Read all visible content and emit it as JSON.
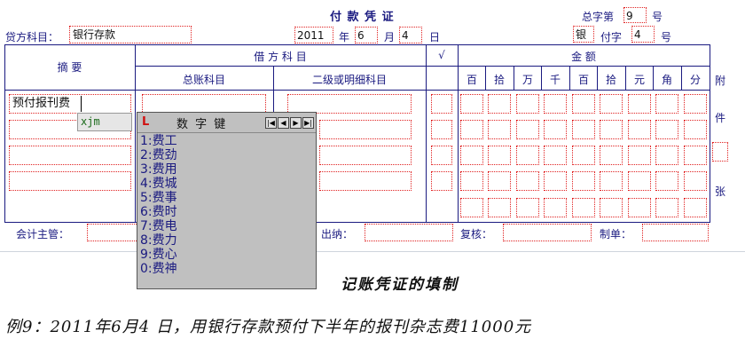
{
  "voucher": {
    "title": "付 款 凭 证",
    "total_no_label": "总字第",
    "total_no": "9",
    "hao": "号",
    "credit_subject_label": "贷方科目：",
    "credit_subject": "银行存款",
    "year": "2011",
    "year_label": "年",
    "month": "6",
    "month_label": "月",
    "day": "4",
    "day_label": "日",
    "word": "银",
    "pay_word_label": "付字",
    "pay_no": "4",
    "hao2": "号"
  },
  "table": {
    "summary_header": "摘  要",
    "debit_header": "借 方 科 目",
    "general_ledger_header": "总账科目",
    "detail_header": "二级或明细科目",
    "check_header": "√",
    "amount_header": "金  额",
    "digits": [
      "百",
      "拾",
      "万",
      "千",
      "百",
      "拾",
      "元",
      "角",
      "分"
    ],
    "attachment_labels": [
      "附",
      "件",
      "张"
    ],
    "row1_summary": "预付报刊费"
  },
  "ime": {
    "composition": "xjm"
  },
  "numpad": {
    "logo": "L",
    "title": "数 字 键",
    "nav": [
      "|◀",
      "◀",
      "▶",
      "▶|"
    ],
    "candidates": [
      "1:费工",
      "2:费劲",
      "3:费用",
      "4:费城",
      "5:费事",
      "6:费时",
      "7:费电",
      "8:费力",
      "9:费心",
      "0:费神"
    ]
  },
  "footer": {
    "supervisor_label": "会计主管：",
    "cashier_label": "出纳：",
    "review_label": "复核：",
    "maker_label": "制单："
  },
  "captions": {
    "heading": "记账凭证的填制",
    "example": "例9：2011年6月4 日，用银行存款预付下半年的报刊杂志费11000元"
  }
}
